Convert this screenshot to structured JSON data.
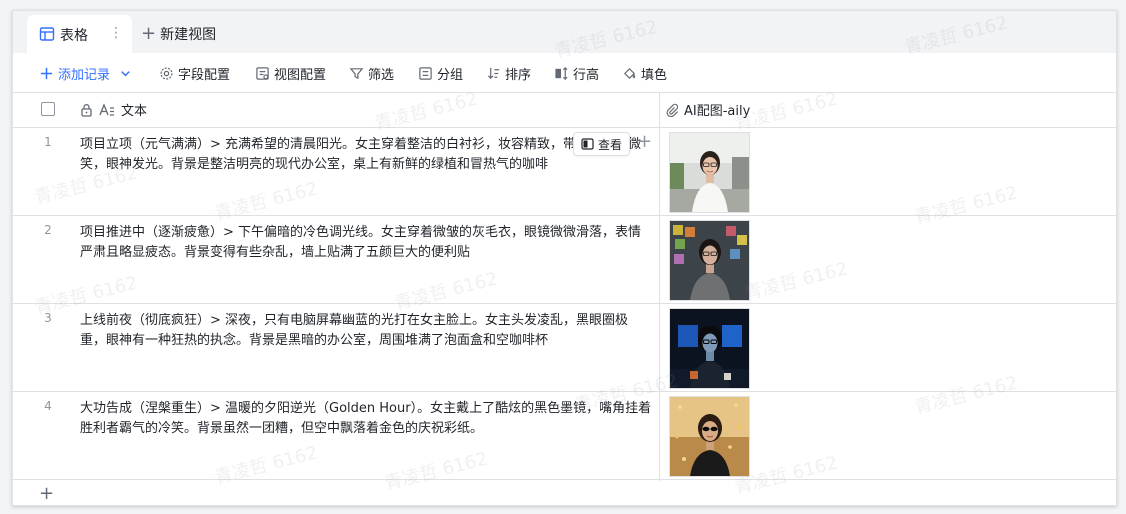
{
  "tabs": [
    {
      "label": "表格",
      "more": "⋮"
    },
    {
      "label": "新建视图"
    }
  ],
  "toolbar": {
    "add_record": "添加记录",
    "field_config": "字段配置",
    "view_config": "视图配置",
    "filter": "筛选",
    "group": "分组",
    "sort": "排序",
    "row_height": "行高",
    "fill_color": "填色"
  },
  "columns": {
    "text": "文本",
    "ai": "AI配图-aily"
  },
  "rows": [
    {
      "num": "1",
      "text": "项目立项（元气满满）> 充满希望的清晨阳光。女主穿着整洁的白衬衫，妆容精致，带着自信的微笑，眼神发光。背景是整洁明亮的现代办公室，桌上有新鲜的绿植和冒热气的咖啡",
      "image": "woman-portrait-office-bright"
    },
    {
      "num": "2",
      "text": "项目推进中（逐渐疲惫）> 下午偏暗的冷色调光线。女主穿着微皱的灰毛衣，眼镜微微滑落，表情严肃且略显疲态。背景变得有些杂乱，墙上贴满了五颜巨大的便利贴",
      "image": "woman-portrait-sticky-notes"
    },
    {
      "num": "3",
      "text": "上线前夜（彻底疯狂）> 深夜，只有电脑屏幕幽蓝的光打在女主脸上。女主头发凌乱，黑眼圈极重，眼神有一种狂热的执念。背景是黑暗的办公室，周围堆满了泡面盒和空咖啡杯",
      "image": "woman-portrait-night-screen"
    },
    {
      "num": "4",
      "text": "大功告成（涅槃重生）> 温暖的夕阳逆光（Golden Hour）。女主戴上了酷炫的黑色墨镜，嘴角挂着胜利者霸气的冷笑。背景虽然一团糟，但空中飘落着金色的庆祝彩纸。",
      "image": "woman-portrait-sunglasses-confetti"
    }
  ],
  "row_action": {
    "view": "查看"
  },
  "watermark": "青凌哲 6162",
  "colors": {
    "accent": "#3370ff",
    "border": "#dee0e3",
    "tab_bg": "#f2f3f5"
  }
}
